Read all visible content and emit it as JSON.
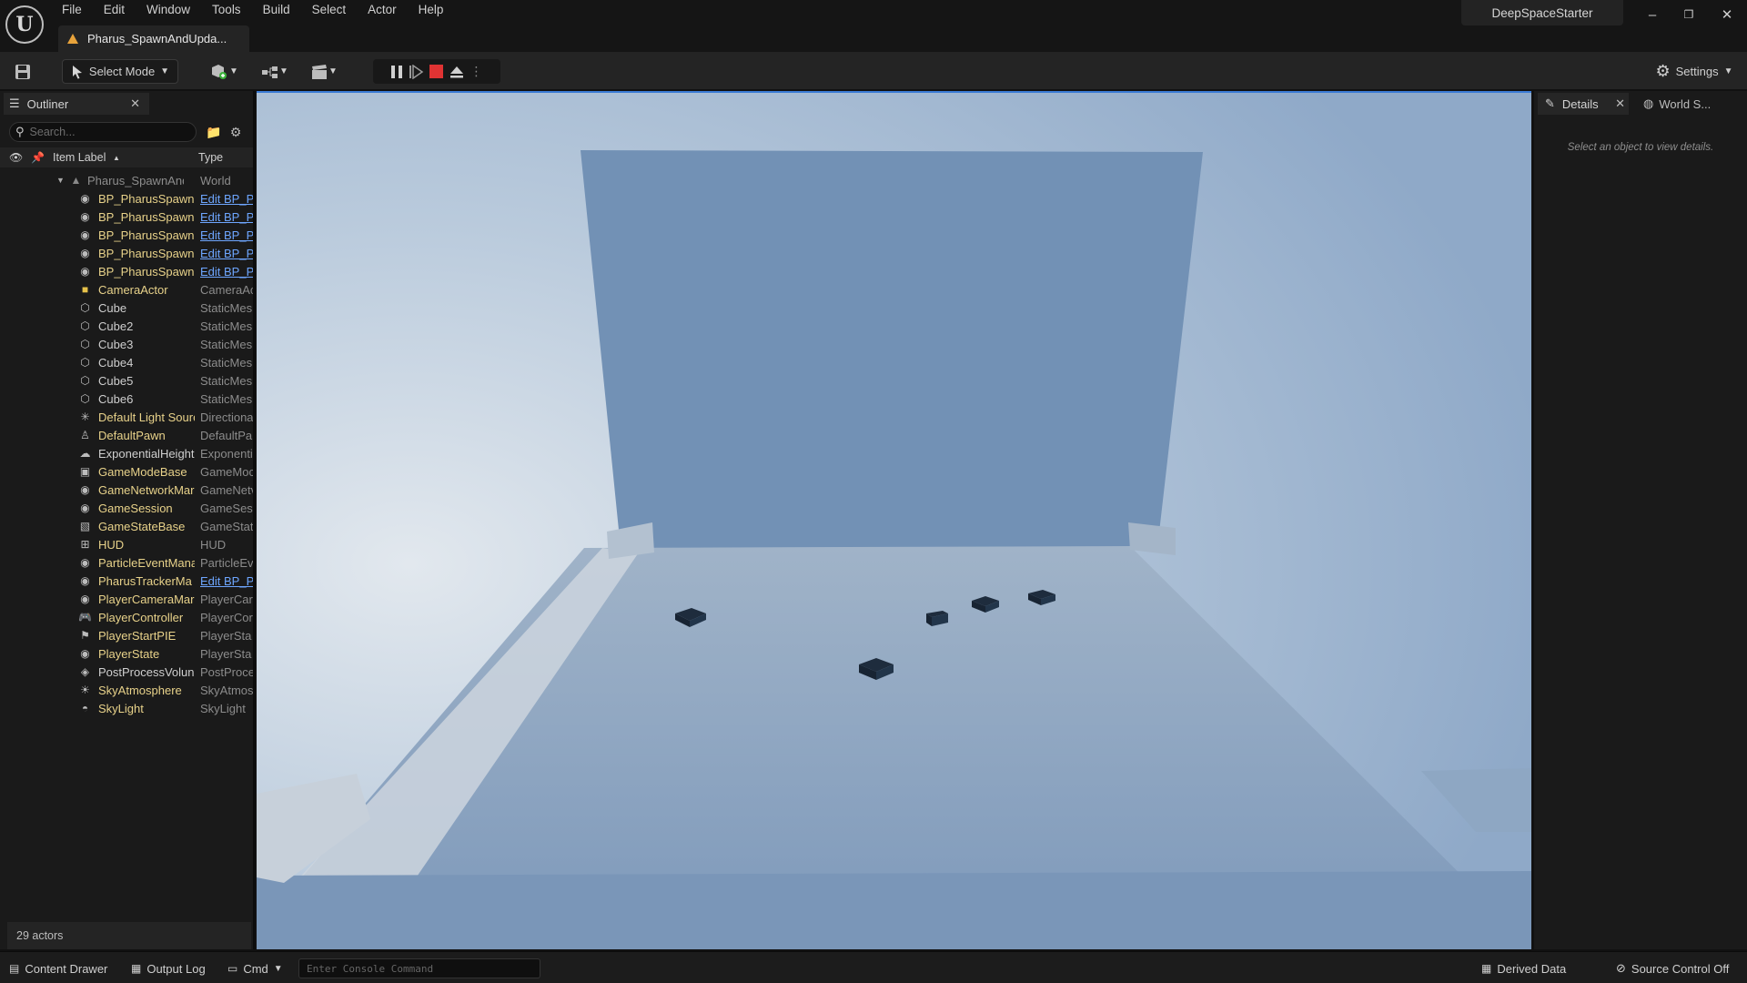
{
  "app": {
    "menu": [
      "File",
      "Edit",
      "Window",
      "Tools",
      "Build",
      "Select",
      "Actor",
      "Help"
    ],
    "document_tab": "Pharus_SpawnAndUpda...",
    "project_name": "DeepSpaceStarter",
    "window_controls": {
      "minimize": "–",
      "restore": "❐",
      "close": "✕"
    }
  },
  "toolbar": {
    "select_mode_label": "Select Mode",
    "settings_label": "Settings"
  },
  "outliner": {
    "tab_label": "Outliner",
    "search_placeholder": "Search...",
    "col_item_label": "Item Label",
    "col_type": "Type",
    "world_row": {
      "label": "Pharus_SpawnAndU",
      "type": "World"
    },
    "rows": [
      {
        "label": "BP_PharusSpawne",
        "type": "Edit BP_P",
        "link": true,
        "icon": "actor-icon"
      },
      {
        "label": "BP_PharusSpawne",
        "type": "Edit BP_P",
        "link": true,
        "icon": "actor-icon"
      },
      {
        "label": "BP_PharusSpawne",
        "type": "Edit BP_P",
        "link": true,
        "icon": "actor-icon"
      },
      {
        "label": "BP_PharusSpawne",
        "type": "Edit BP_P",
        "link": true,
        "icon": "actor-icon"
      },
      {
        "label": "BP_PharusSpawne",
        "type": "Edit BP_P",
        "link": true,
        "icon": "actor-icon"
      },
      {
        "label": "CameraActor",
        "type": "CameraAc",
        "link": false,
        "icon": "camera-icon"
      },
      {
        "label": "Cube",
        "type": "StaticMes",
        "link": false,
        "icon": "cube-icon"
      },
      {
        "label": "Cube2",
        "type": "StaticMes",
        "link": false,
        "icon": "cube-icon"
      },
      {
        "label": "Cube3",
        "type": "StaticMes",
        "link": false,
        "icon": "cube-icon"
      },
      {
        "label": "Cube4",
        "type": "StaticMes",
        "link": false,
        "icon": "cube-icon"
      },
      {
        "label": "Cube5",
        "type": "StaticMes",
        "link": false,
        "icon": "cube-icon"
      },
      {
        "label": "Cube6",
        "type": "StaticMes",
        "link": false,
        "icon": "cube-icon"
      },
      {
        "label": "Default Light Sourc",
        "type": "Directiona",
        "link": false,
        "icon": "directional-light-icon"
      },
      {
        "label": "DefaultPawn",
        "type": "DefaultPa",
        "link": false,
        "icon": "pawn-icon"
      },
      {
        "label": "ExponentialHeightI",
        "type": "Exponenti",
        "link": false,
        "icon": "fog-icon"
      },
      {
        "label": "GameModeBase",
        "type": "GameMoc",
        "link": false,
        "icon": "game-mode-icon"
      },
      {
        "label": "GameNetworkMar",
        "type": "GameNetv",
        "link": false,
        "icon": "actor-icon"
      },
      {
        "label": "GameSession",
        "type": "GameSes",
        "link": false,
        "icon": "actor-icon"
      },
      {
        "label": "GameStateBase",
        "type": "GameStat",
        "link": false,
        "icon": "game-state-icon"
      },
      {
        "label": "HUD",
        "type": "HUD",
        "link": false,
        "icon": "hud-icon"
      },
      {
        "label": "ParticleEventMana",
        "type": "ParticleEv",
        "link": false,
        "icon": "actor-icon"
      },
      {
        "label": "PharusTrackerMa",
        "type": "Edit BP_P",
        "link": true,
        "icon": "actor-icon"
      },
      {
        "label": "PlayerCameraMar",
        "type": "PlayerCar",
        "link": false,
        "icon": "actor-icon"
      },
      {
        "label": "PlayerController",
        "type": "PlayerCor",
        "link": false,
        "icon": "gamepad-icon"
      },
      {
        "label": "PlayerStartPIE",
        "type": "PlayerSta",
        "link": false,
        "icon": "player-start-icon"
      },
      {
        "label": "PlayerState",
        "type": "PlayerSta",
        "link": false,
        "icon": "actor-icon"
      },
      {
        "label": "PostProcessVolun",
        "type": "PostProce",
        "link": false,
        "icon": "post-process-icon"
      },
      {
        "label": "SkyAtmosphere",
        "type": "SkyAtmos",
        "link": false,
        "icon": "sky-atmosphere-icon"
      },
      {
        "label": "SkyLight",
        "type": "SkyLight",
        "link": false,
        "icon": "sky-light-icon"
      }
    ],
    "actor_count": "29 actors"
  },
  "details": {
    "tab_label": "Details",
    "world_tab_label": "World S...",
    "hint": "Select an object to view details."
  },
  "statusbar": {
    "content_drawer": "Content Drawer",
    "output_log": "Output Log",
    "cmd": "Cmd",
    "console_placeholder": "Enter Console Command",
    "derived_data": "Derived Data",
    "source_control": "Source Control Off"
  },
  "colors": {
    "accent_blue": "#3a7bd5",
    "stop_red": "#e03333",
    "label_yellow": "#e8d28a",
    "link_blue": "#6ea6ff"
  }
}
